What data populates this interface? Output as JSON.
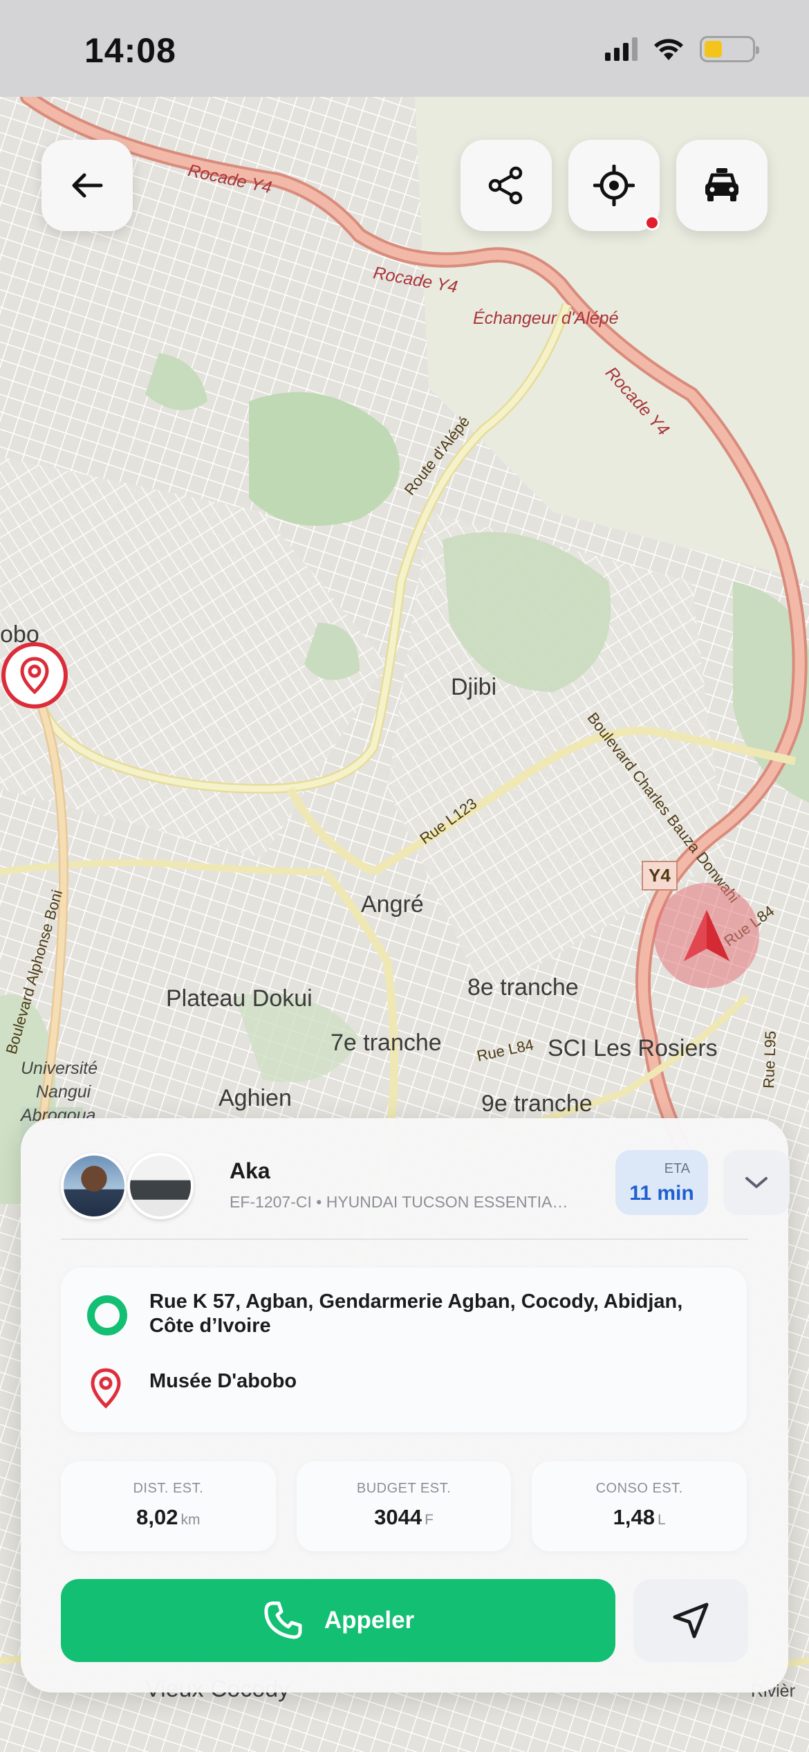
{
  "status_bar": {
    "time": "14:08"
  },
  "map": {
    "labels": {
      "rocade_1": "Rocade Y4",
      "rocade_2": "Rocade Y4",
      "rocade_3": "Rocade Y4",
      "echangeur": "Échangeur d'Alépé",
      "route_alepe": "Route d'Alépé",
      "abobo": "obo",
      "djibi": "Djibi",
      "bd_charles": "Boulevard Charles Bauza Donwahi",
      "rue_l123": "Rue L123",
      "y4_badge": "Y4",
      "rue_l84_a": "Rue L84",
      "rue_l84_b": "Rue L84",
      "rue_l95": "Rue L95",
      "angre": "Angré",
      "plateau_dokui": "Plateau Dokui",
      "huitieme": "8e tranche",
      "septieme": "7e tranche",
      "neuvieme": "9e tranche",
      "sci_rosiers": "SCI Les Rosiers",
      "universite": "Université",
      "nangui": "Nangui",
      "abrogoua": "Abrogoua",
      "aghien": "Aghien",
      "bd_alphonse": "Boulevard Alphonse Boni",
      "vieux_cocody": "Vieux Cocody",
      "riviera": "Rivièr"
    }
  },
  "toolbar": {
    "back_icon": "arrow-left-icon",
    "share_icon": "share-icon",
    "locate_icon": "crosshair-icon",
    "taxi_icon": "taxi-icon"
  },
  "driver": {
    "name": "Aka",
    "vehicle": "EF-1207-CI • HYUNDAI TUCSON ESSENTIAL T...",
    "eta_label": "ETA",
    "eta_value": "11 min"
  },
  "route": {
    "origin": "Rue K 57, Agban, Gendarmerie Agban, Cocody, Abidjan, Côte d’Ivoire",
    "destination": "Musée D'abobo"
  },
  "stats": [
    {
      "label": "DIST. EST.",
      "value": "8,02",
      "unit": "km"
    },
    {
      "label": "BUDGET EST.",
      "value": "3044",
      "unit": "F"
    },
    {
      "label": "CONSO EST.",
      "value": "1,48",
      "unit": "L"
    }
  ],
  "actions": {
    "call_label": "Appeler"
  },
  "colors": {
    "accent_green": "#12bf73",
    "eta_blue": "#1f5fcf",
    "marker_red": "#dc2c3a",
    "rocade_orange": "#e8a08e"
  }
}
